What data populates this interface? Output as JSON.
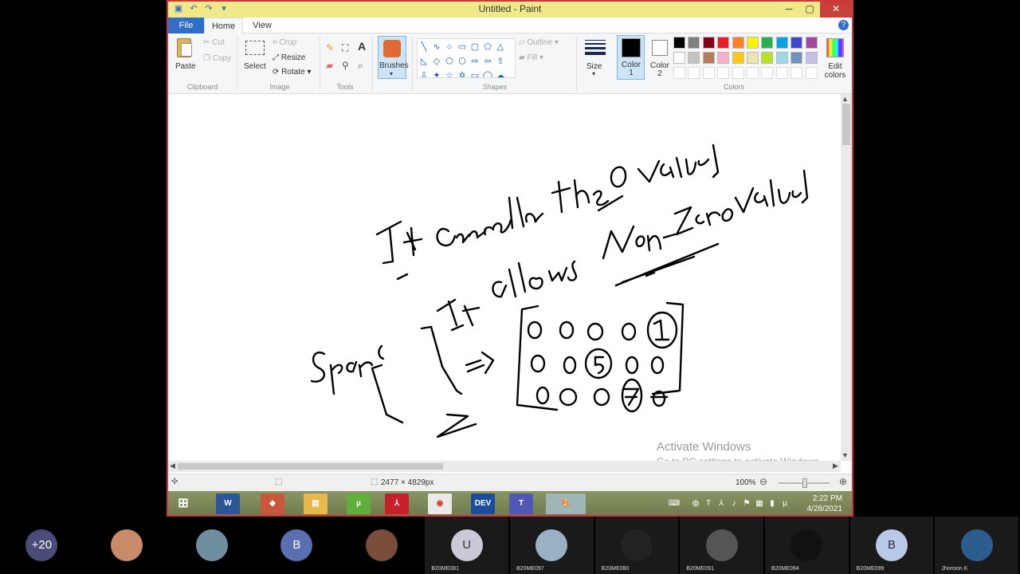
{
  "window": {
    "title": "Untitled - Paint",
    "min": "─",
    "max": "▢",
    "close": "✕"
  },
  "tabs": {
    "file": "File",
    "home": "Home",
    "view": "View"
  },
  "ribbon": {
    "clipboard": {
      "paste": "Paste",
      "cut": "Cut",
      "copy": "Copy",
      "label": "Clipboard"
    },
    "image": {
      "select": "Select",
      "crop": "Crop",
      "resize": "Resize",
      "rotate": "Rotate",
      "label": "Image"
    },
    "tools": {
      "label": "Tools"
    },
    "brushes": {
      "label": "Brushes"
    },
    "shapes": {
      "outline": "Outline",
      "fill": "Fill",
      "label": "Shapes"
    },
    "size": {
      "label": "Size"
    },
    "color1": {
      "label": "Color 1",
      "value": "#000000"
    },
    "color2": {
      "label": "Color 2",
      "value": "#ffffff"
    },
    "edit_colors": "Edit colors",
    "colors_label": "Colors",
    "palette_row1": [
      "#000000",
      "#7f7f7f",
      "#880015",
      "#ed1c24",
      "#ff7f27",
      "#fff200",
      "#22b14c",
      "#00a2e8",
      "#3f48cc",
      "#a349a4"
    ],
    "palette_row2": [
      "#ffffff",
      "#c3c3c3",
      "#b97a57",
      "#ffaec9",
      "#ffc90e",
      "#efe4b0",
      "#b5e61d",
      "#99d9ea",
      "#7092be",
      "#c8bfe7"
    ]
  },
  "canvas": {
    "watermark_title": "Activate Windows",
    "watermark_sub": "Go to PC settings to activate Windows."
  },
  "statusbar": {
    "dimensions": "2477 × 4829px",
    "zoom": "100%"
  },
  "taskbar": {
    "apps": [
      "start",
      "word",
      "app",
      "explorer",
      "utorrent",
      "acrobat",
      "chrome",
      "dev",
      "teams",
      "paint"
    ],
    "clock_time": "2:22 PM",
    "clock_date": "4/28/2021"
  },
  "participants": [
    {
      "kind": "count",
      "label": "+20",
      "color": "#4b4b7a"
    },
    {
      "kind": "photo",
      "label": "",
      "color": "#c98a6a"
    },
    {
      "kind": "photo",
      "label": "",
      "color": "#6f8f9e"
    },
    {
      "kind": "initial",
      "label": "B",
      "color": "#5a6fb0"
    },
    {
      "kind": "photo",
      "label": "",
      "color": "#7a4d3a"
    },
    {
      "kind": "initial",
      "label": "U",
      "color": "#c9c9d8",
      "name": "B20ME081"
    },
    {
      "kind": "photo",
      "label": "",
      "color": "#9ab0c4",
      "name": "B20ME097"
    },
    {
      "kind": "photo",
      "label": "",
      "color": "#222222",
      "name": "B20ME080"
    },
    {
      "kind": "photo",
      "label": "",
      "color": "#555555",
      "name": "B20ME091"
    },
    {
      "kind": "photo",
      "label": "",
      "color": "#111111",
      "name": "B20ME094"
    },
    {
      "kind": "initial",
      "label": "B",
      "color": "#b9c9e8",
      "name": "B20ME099"
    },
    {
      "kind": "photo",
      "label": "",
      "color": "#2c5d8f",
      "name": "Jhonson K"
    }
  ]
}
